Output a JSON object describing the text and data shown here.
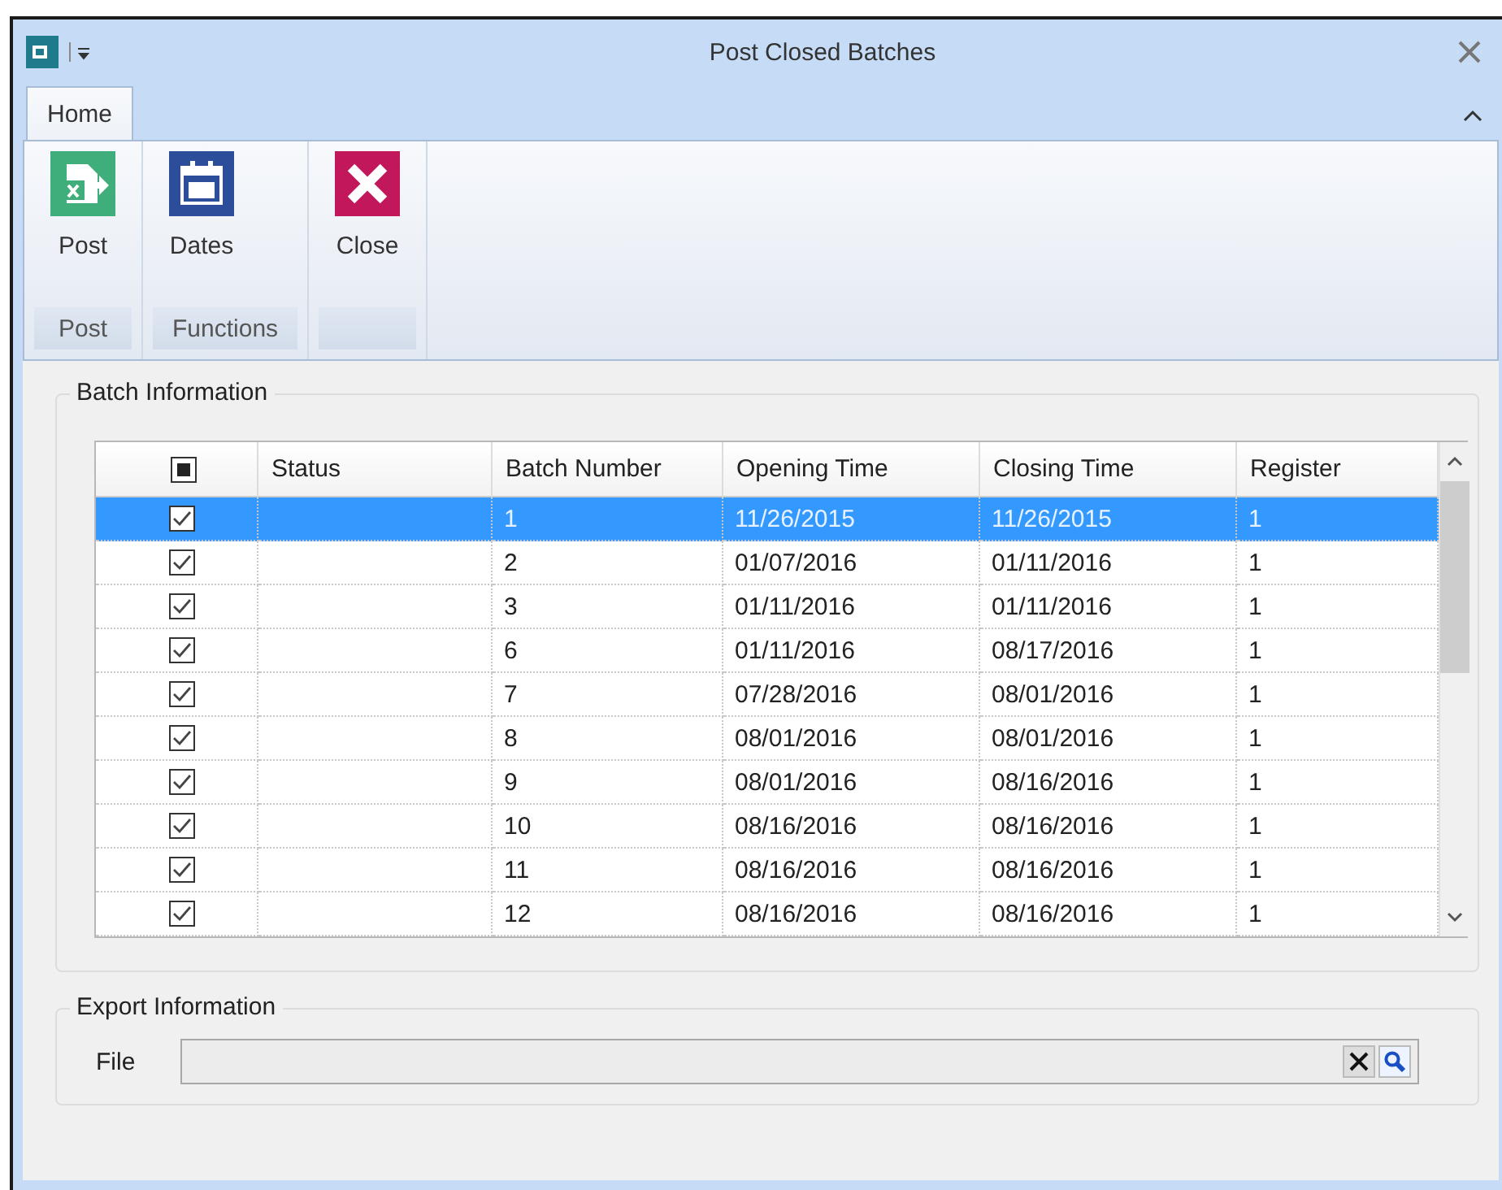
{
  "window": {
    "title": "Post Closed Batches"
  },
  "tabs": [
    {
      "label": "Home",
      "selected": true
    }
  ],
  "ribbon": {
    "groups": [
      {
        "label": "Post",
        "buttons": [
          {
            "label": "Post",
            "kind": "post"
          }
        ]
      },
      {
        "label": "Functions",
        "buttons": [
          {
            "label": "Dates",
            "kind": "dates"
          }
        ]
      },
      {
        "buttons": [
          {
            "label": "Close",
            "kind": "close"
          }
        ]
      }
    ]
  },
  "batch_information": {
    "title": "Batch Information",
    "table": {
      "select_all_checked": true,
      "columns": [
        "Status",
        "Batch Number",
        "Opening Time",
        "Closing Time",
        "Register"
      ],
      "rows": [
        {
          "checked": true,
          "selected": true,
          "cells": [
            "",
            "1",
            "11/26/2015",
            "11/26/2015",
            "1"
          ]
        },
        {
          "checked": true,
          "selected": false,
          "cells": [
            "",
            "2",
            "01/07/2016",
            "01/11/2016",
            "1"
          ]
        },
        {
          "checked": true,
          "selected": false,
          "cells": [
            "",
            "3",
            "01/11/2016",
            "01/11/2016",
            "1"
          ]
        },
        {
          "checked": true,
          "selected": false,
          "cells": [
            "",
            "6",
            "01/11/2016",
            "08/17/2016",
            "1"
          ]
        },
        {
          "checked": true,
          "selected": false,
          "cells": [
            "",
            "7",
            "07/28/2016",
            "08/01/2016",
            "1"
          ]
        },
        {
          "checked": true,
          "selected": false,
          "cells": [
            "",
            "8",
            "08/01/2016",
            "08/01/2016",
            "1"
          ]
        },
        {
          "checked": true,
          "selected": false,
          "cells": [
            "",
            "9",
            "08/01/2016",
            "08/16/2016",
            "1"
          ]
        },
        {
          "checked": true,
          "selected": false,
          "cells": [
            "",
            "10",
            "08/16/2016",
            "08/16/2016",
            "1"
          ]
        },
        {
          "checked": true,
          "selected": false,
          "cells": [
            "",
            "11",
            "08/16/2016",
            "08/16/2016",
            "1"
          ]
        },
        {
          "checked": true,
          "selected": false,
          "cells": [
            "",
            "12",
            "08/16/2016",
            "08/16/2016",
            "1"
          ]
        }
      ]
    }
  },
  "export_information": {
    "title": "Export Information",
    "file_label": "File"
  }
}
